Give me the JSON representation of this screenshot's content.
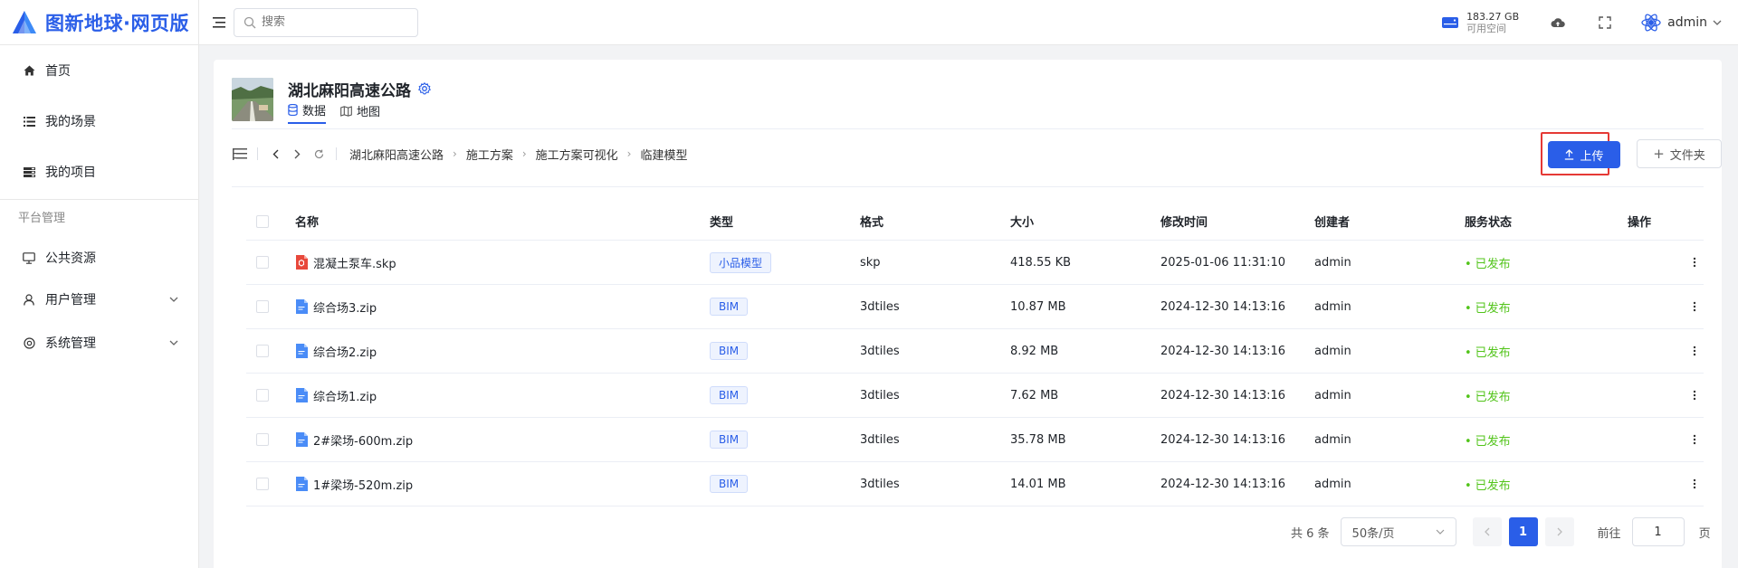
{
  "app": {
    "title": "图新地球·网页版",
    "brand_color": "#2a5ee8"
  },
  "header": {
    "search_placeholder": "搜索",
    "disk_size": "183.27 GB",
    "disk_label": "可用空间",
    "user_name": "admin"
  },
  "sidebar": {
    "items": [
      {
        "label": "首页",
        "icon": "home-icon"
      },
      {
        "label": "我的场景",
        "icon": "list-icon"
      },
      {
        "label": "我的项目",
        "icon": "project-icon"
      }
    ],
    "group_title": "平台管理",
    "admin_items": [
      {
        "label": "公共资源",
        "icon": "monitor-icon"
      },
      {
        "label": "用户管理",
        "icon": "user-icon"
      },
      {
        "label": "系统管理",
        "icon": "settings-icon"
      }
    ]
  },
  "project": {
    "title": "湖北麻阳高速公路",
    "tabs": [
      {
        "label": "数据",
        "active": true
      },
      {
        "label": "地图",
        "active": false
      }
    ]
  },
  "breadcrumb": [
    "湖北麻阳高速公路",
    "施工方案",
    "施工方案可视化",
    "临建模型"
  ],
  "toolbar": {
    "upload_label": "上传",
    "folder_label": "文件夹"
  },
  "table": {
    "headers": {
      "name": "名称",
      "type": "类型",
      "format": "格式",
      "size": "大小",
      "modified": "修改时间",
      "creator": "创建者",
      "status": "服务状态",
      "actions": "操作"
    },
    "rows": [
      {
        "name": "混凝土泵车.skp",
        "type": "小品模型",
        "format": "skp",
        "size": "418.55 KB",
        "modified": "2025-01-06 11:31:10",
        "creator": "admin",
        "status": "已发布",
        "icon": "skp-file-icon"
      },
      {
        "name": "综合场3.zip",
        "type": "BIM",
        "format": "3dtiles",
        "size": "10.87 MB",
        "modified": "2024-12-30 14:13:16",
        "creator": "admin",
        "status": "已发布",
        "icon": "zip-file-icon"
      },
      {
        "name": "综合场2.zip",
        "type": "BIM",
        "format": "3dtiles",
        "size": "8.92 MB",
        "modified": "2024-12-30 14:13:16",
        "creator": "admin",
        "status": "已发布",
        "icon": "zip-file-icon"
      },
      {
        "name": "综合场1.zip",
        "type": "BIM",
        "format": "3dtiles",
        "size": "7.62 MB",
        "modified": "2024-12-30 14:13:16",
        "creator": "admin",
        "status": "已发布",
        "icon": "zip-file-icon"
      },
      {
        "name": "2#梁场-600m.zip",
        "type": "BIM",
        "format": "3dtiles",
        "size": "35.78 MB",
        "modified": "2024-12-30 14:13:16",
        "creator": "admin",
        "status": "已发布",
        "icon": "zip-file-icon"
      },
      {
        "name": "1#梁场-520m.zip",
        "type": "BIM",
        "format": "3dtiles",
        "size": "14.01 MB",
        "modified": "2024-12-30 14:13:16",
        "creator": "admin",
        "status": "已发布",
        "icon": "zip-file-icon"
      }
    ]
  },
  "pagination": {
    "total_label": "共 6 条",
    "page_size": "50条/页",
    "current_page": "1",
    "goto_label": "前往",
    "goto_value": "1",
    "page_unit": "页"
  },
  "colors": {
    "status_published": "#52c41a",
    "highlight_frame": "#e53935"
  }
}
